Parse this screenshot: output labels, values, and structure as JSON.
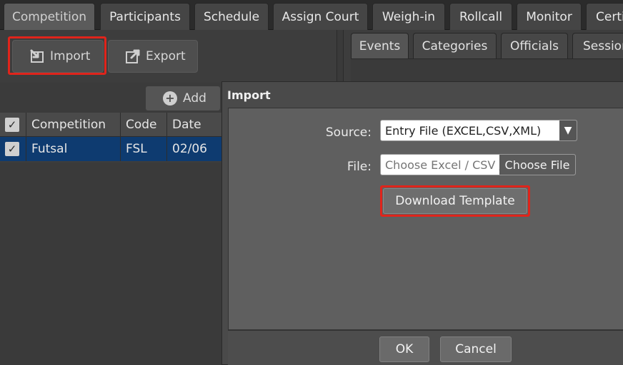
{
  "top_tabs": [
    "Competition",
    "Participants",
    "Schedule",
    "Assign Court",
    "Weigh-in",
    "Rollcall",
    "Monitor",
    "Certi"
  ],
  "toolbar": {
    "import_label": "Import",
    "export_label": "Export",
    "add_label": "Add"
  },
  "grid": {
    "columns": [
      "Competition",
      "Code",
      "Date"
    ],
    "rows": [
      {
        "competition": "Futsal",
        "code": "FSL",
        "date": "02/06"
      }
    ]
  },
  "right_tabs": [
    "Events",
    "Categories",
    "Officials",
    "Session"
  ],
  "modal": {
    "title": "Import",
    "source_label": "Source:",
    "source_value": "Entry File (EXCEL,CSV,XML)",
    "file_label": "File:",
    "file_placeholder": "Choose Excel / CSV / XML",
    "choose_file_label": "Choose File",
    "download_template_label": "Download Template",
    "ok_label": "OK",
    "cancel_label": "Cancel"
  },
  "colors": {
    "highlight": "#e0241b",
    "selected_row": "#0e3b70"
  }
}
